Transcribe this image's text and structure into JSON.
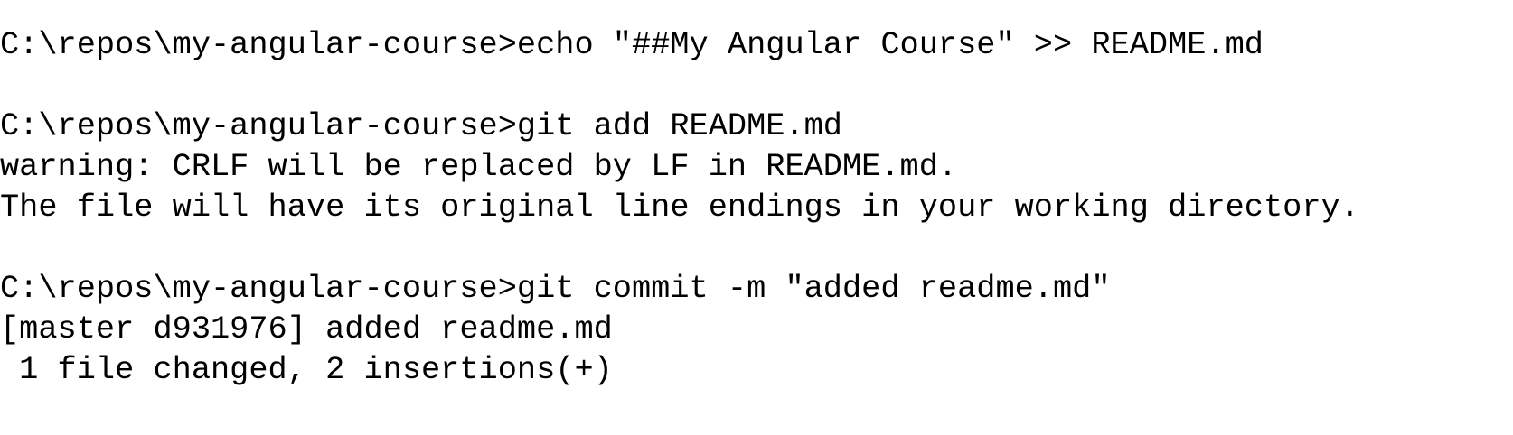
{
  "terminal": {
    "lines": [
      "C:\\repos\\my-angular-course>echo \"##My Angular Course\" >> README.md",
      "",
      "C:\\repos\\my-angular-course>git add README.md",
      "warning: CRLF will be replaced by LF in README.md.",
      "The file will have its original line endings in your working directory.",
      "",
      "C:\\repos\\my-angular-course>git commit -m \"added readme.md\"",
      "[master d931976] added readme.md",
      " 1 file changed, 2 insertions(+)"
    ]
  }
}
